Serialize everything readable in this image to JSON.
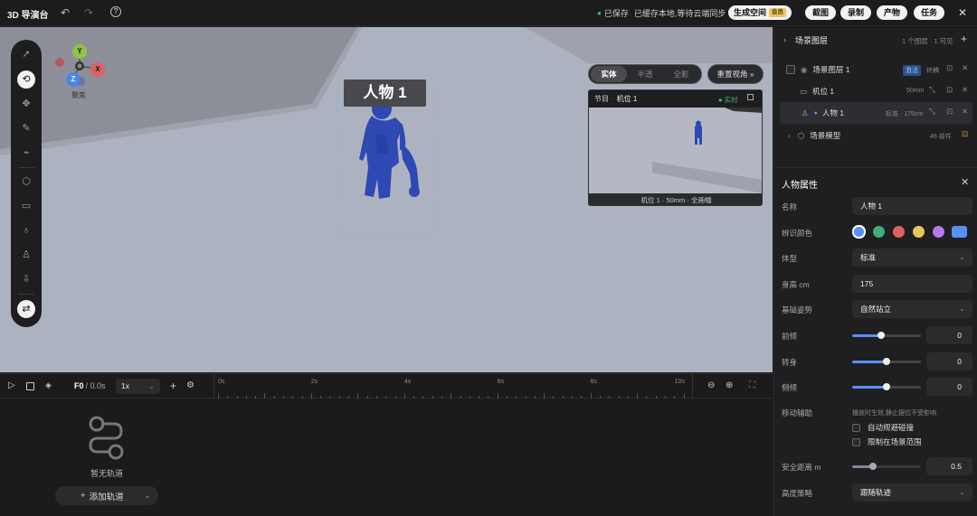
{
  "app": {
    "title": "3D 导演台"
  },
  "topbar": {
    "saved": "已保存",
    "sync_status": "已缓存本地,等待云端同步",
    "generate_space": "生成空间",
    "vip_badge": "会员",
    "screenshot": "截图",
    "record": "录制",
    "output": "产物",
    "tasks": "任务"
  },
  "gizmo": {
    "y": "Y",
    "x": "X",
    "z": "Z",
    "label": "聚焦"
  },
  "viewport": {
    "character_label": "人物 1",
    "modes": [
      "实体",
      "半透",
      "全影"
    ],
    "reset_view": "重置视角 »"
  },
  "preview": {
    "program": "节目",
    "camera": "机位 1",
    "live": "● 实时",
    "footer": "机位 1 · 50mm · 全画幅"
  },
  "timeline": {
    "frame": "F0",
    "time": "/ 0.0s",
    "speed": "1x",
    "ticks": [
      "0s",
      "2s",
      "4s",
      "6s",
      "8s",
      "10s"
    ],
    "empty_text": "暂无轨道",
    "add_track": "添加轨道"
  },
  "layers": {
    "title": "场景图层",
    "summary": "1 个图层 · 1 可见",
    "items": [
      {
        "name": "场景图层 1",
        "tag": "激活",
        "meta": "终稿"
      },
      {
        "name": "机位 1",
        "meta": "50mm"
      },
      {
        "name": "人物 1",
        "meta": "标准 · 175cm"
      },
      {
        "name": "场景模型",
        "meta": "46 部件"
      }
    ]
  },
  "props": {
    "title": "人物属性",
    "name_label": "名称",
    "name_value": "人物 1",
    "color_label": "辨识颜色",
    "colors": [
      "#5b8ef6",
      "#3fae7a",
      "#e0625f",
      "#e8c65d",
      "#b57af0",
      "#5b8ef6"
    ],
    "body_label": "体型",
    "body_value": "标准",
    "height_label": "身高 cm",
    "height_value": "175",
    "pose_label": "基础姿势",
    "pose_value": "自然站立",
    "lean_label": "前倾",
    "lean_value": "0",
    "lean_level": 0.42,
    "turn_label": "转身",
    "turn_value": "0",
    "turn_level": 0.5,
    "tilt_label": "侧倾",
    "tilt_value": "0",
    "tilt_level": 0.5,
    "assist_label": "移动辅助",
    "assist_note": "播放时生效,静止摆位不受影响",
    "avoid_label": "自动规避碰撞",
    "limit_label": "限制在场景范围",
    "safe_label": "安全距离 m",
    "safe_value": "0.5",
    "safe_level": 0.3,
    "height_strategy_label": "高度策略",
    "height_strategy_value": "跟随轨迹"
  }
}
